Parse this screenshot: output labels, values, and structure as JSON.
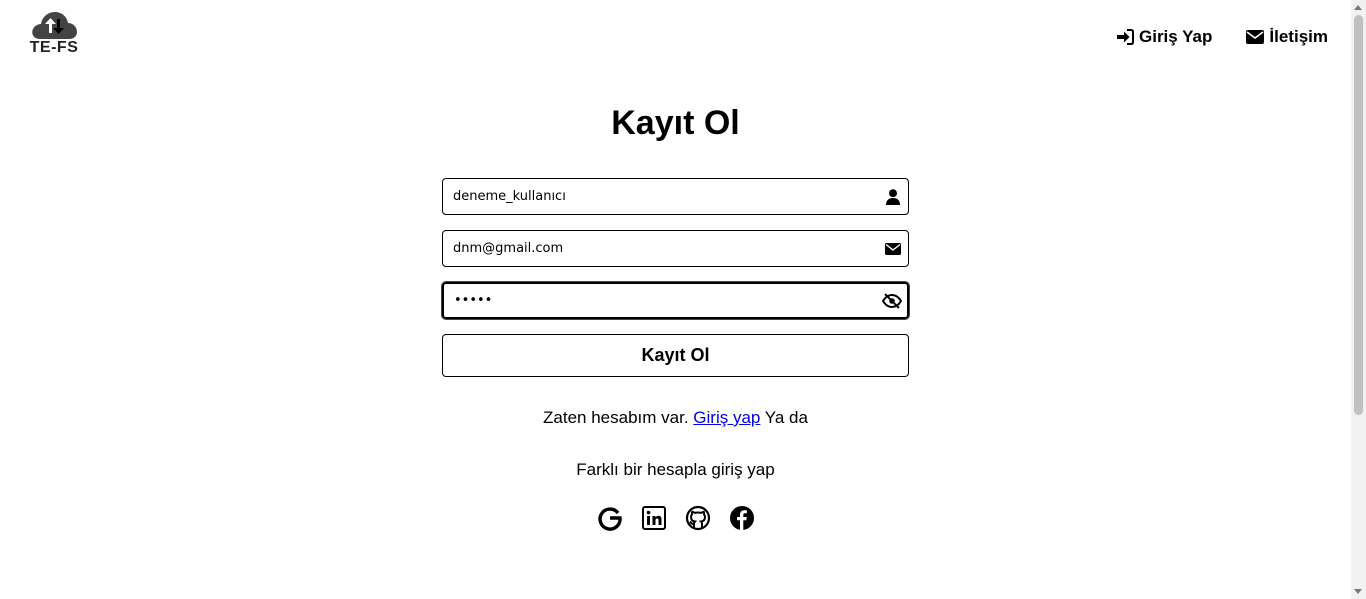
{
  "logo": {
    "text": "TE-FS",
    "icon": "cloud-upload-download-icon"
  },
  "nav": {
    "login": {
      "label": "Giriş Yap",
      "icon": "sign-in-icon"
    },
    "contact": {
      "label": "İletişim",
      "icon": "envelope-icon"
    }
  },
  "form": {
    "title": "Kayıt Ol",
    "username": {
      "value": "deneme_kullanıcı",
      "icon": "user-icon"
    },
    "email": {
      "value": "dnm@gmail.com",
      "icon": "envelope-icon"
    },
    "password": {
      "value": "•••••",
      "icon": "eye-slash-icon"
    },
    "submit_label": "Kayıt Ol"
  },
  "footer": {
    "have_account_text": "Zaten hesabım var.",
    "login_link": "Giriş yap",
    "or_text": "Ya da",
    "other_account_text": "Farklı bir hesapla giriş yap",
    "socials": [
      "google-icon",
      "linkedin-icon",
      "github-icon",
      "facebook-icon"
    ]
  }
}
